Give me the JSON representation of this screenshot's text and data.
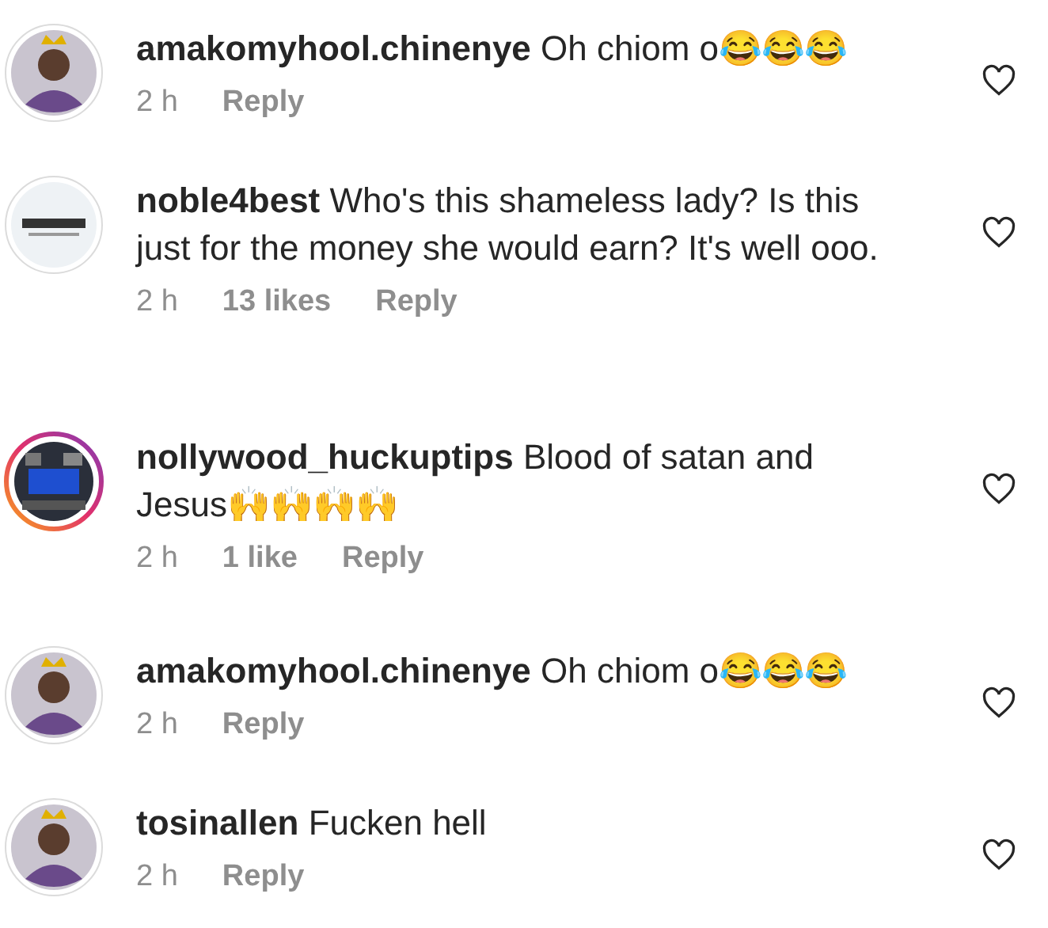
{
  "comments": [
    {
      "avatar": {
        "kind": "person",
        "story_ring": false
      },
      "username": "amakomyhool.chinenye",
      "text": "Oh chiom o😂😂😂",
      "time": "2 h",
      "reply": "Reply"
    },
    {
      "avatar": {
        "kind": "logo",
        "story_ring": false
      },
      "username": "noble4best",
      "text": "Who's this shameless lady? Is this just for the money she would earn? It's well ooo.",
      "time": "2 h",
      "likes": "13 likes",
      "reply": "Reply"
    },
    {
      "avatar": {
        "kind": "picture",
        "story_ring": true
      },
      "username": "nollywood_huckuptips",
      "text": "Blood of satan and Jesus🙌🙌🙌🙌",
      "time": "2 h",
      "likes": "1 like",
      "reply": "Reply"
    },
    {
      "avatar": {
        "kind": "person",
        "story_ring": false
      },
      "username": "amakomyhool.chinenye",
      "text": "Oh chiom o😂😂😂",
      "time": "2 h",
      "reply": "Reply"
    },
    {
      "avatar": {
        "kind": "person",
        "story_ring": false
      },
      "username": "tosinallen",
      "text": "Fucken hell",
      "time": "2 h",
      "reply": "Reply"
    }
  ]
}
